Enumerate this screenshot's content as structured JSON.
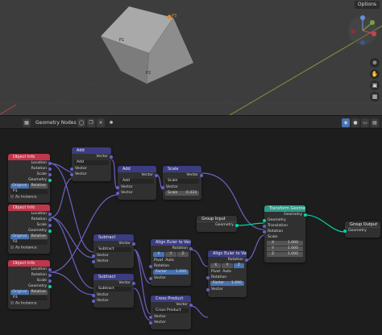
{
  "viewport": {
    "options_label": "Options",
    "cube_labels": [
      "P1",
      "P2",
      "P3"
    ]
  },
  "header": {
    "editor_name": "Geometry Nodes",
    "icons": [
      "editor-type-icon",
      "pin-icon"
    ]
  },
  "nodes": {
    "object_info": {
      "title": "Object Info",
      "outputs": [
        "Location",
        "Rotation",
        "Scale",
        "Geometry"
      ],
      "mode": [
        "Original",
        "Relative"
      ],
      "objects": [
        "P1",
        "P2",
        "P3"
      ],
      "as_instance": "As Instance"
    },
    "add1": {
      "title": "Add",
      "output": "Vector",
      "op": "Add",
      "inputs": [
        "Vector",
        "Vector"
      ]
    },
    "add2": {
      "title": "Add",
      "output": "Vector",
      "op": "Add",
      "inputs": [
        "Vector",
        "Vector"
      ]
    },
    "scale": {
      "title": "Scale",
      "output": "Vector",
      "op": "Scale",
      "inputs": [
        "Vector"
      ],
      "scale_label": "Scale",
      "scale_value": "0.333"
    },
    "subtract1": {
      "title": "Subtract",
      "output": "Vector",
      "op": "Subtract",
      "inputs": [
        "Vector",
        "Vector"
      ]
    },
    "subtract2": {
      "title": "Subtract",
      "output": "Vector",
      "op": "Subtract",
      "inputs": [
        "Vector",
        "Vector"
      ]
    },
    "group_input": {
      "title": "Group Input",
      "output": "Geometry"
    },
    "align1": {
      "title": "Align Euler to Vector",
      "output": "Rotation",
      "axes": [
        "X",
        "Y",
        "Z"
      ],
      "pivot_label": "Pivot",
      "pivot_value": "Auto",
      "inputs": [
        "Rotation"
      ],
      "factor_label": "Factor",
      "factor_value": "1.000",
      "vector": "Vector"
    },
    "align2": {
      "title": "Align Euler to Vector",
      "output": "Rotation",
      "axes": [
        "X",
        "Y",
        "Z"
      ],
      "pivot_label": "Pivot",
      "pivot_value": "Auto",
      "inputs": [
        "Rotation"
      ],
      "factor_label": "Factor",
      "factor_value": "1.000",
      "vector": "Vector"
    },
    "cross": {
      "title": "Cross Product",
      "output": "Vector",
      "op": "Cross Product",
      "inputs": [
        "Vector",
        "Vector"
      ]
    },
    "transform": {
      "title": "Transform Geometry",
      "output": "Geometry",
      "inputs": [
        "Geometry",
        "Translation",
        "Rotation"
      ],
      "scale_label": "Scale",
      "scale": [
        {
          "axis": "X",
          "value": "1.000"
        },
        {
          "axis": "Y",
          "value": "1.000"
        },
        {
          "axis": "Z",
          "value": "1.000"
        }
      ]
    },
    "group_output": {
      "title": "Group Output",
      "input": "Geometry"
    }
  },
  "colors": {
    "object_header": "#c0364b",
    "vector_header": "#3c3c83",
    "transform_header": "#2f9a8a",
    "geometry_socket": "#00d6a3",
    "vector_socket": "#6363c7",
    "wire": "#6d62c4",
    "geometry_wire": "#00d6a3"
  }
}
